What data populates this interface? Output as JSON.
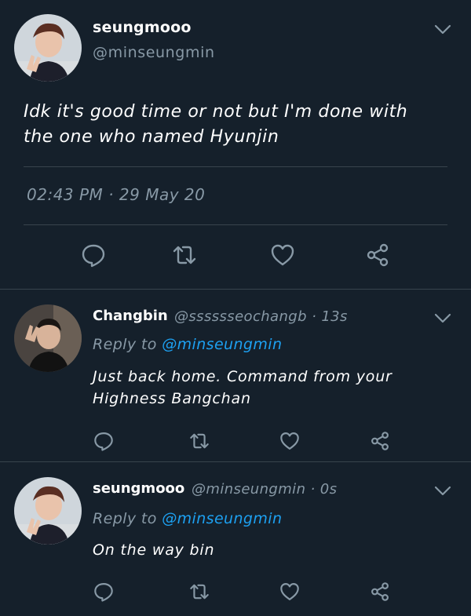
{
  "main_tweet": {
    "name": "seungmooo",
    "handle": "@minseungmin",
    "text_line1": "Idk it's good time or not but I'm done with",
    "text_line2": "the one who named Hyunjin",
    "timestamp": "02:43 PM · 29 May 20"
  },
  "replies": [
    {
      "name": "Changbin",
      "handle_time": "@sssssseochangb · 13s",
      "reply_prefix": "Reply to ",
      "reply_to": "@minseungmin",
      "text_line1": "Just back home. Command from your",
      "text_line2": "Highness Bangchan"
    },
    {
      "name": "seungmooo",
      "handle_time": "@minseungmin · 0s",
      "reply_prefix": "Reply to ",
      "reply_to": "@minseungmin",
      "text_line1": "On the way bin",
      "text_line2": ""
    }
  ],
  "icons": [
    "comment-icon",
    "retweet-icon",
    "like-icon",
    "share-icon",
    "chevron-down-icon"
  ],
  "colors": {
    "background": "#15202b",
    "primary_text": "#ffffff",
    "secondary_text": "#8899a6",
    "link": "#1da1f2",
    "divider": "#38444d"
  }
}
